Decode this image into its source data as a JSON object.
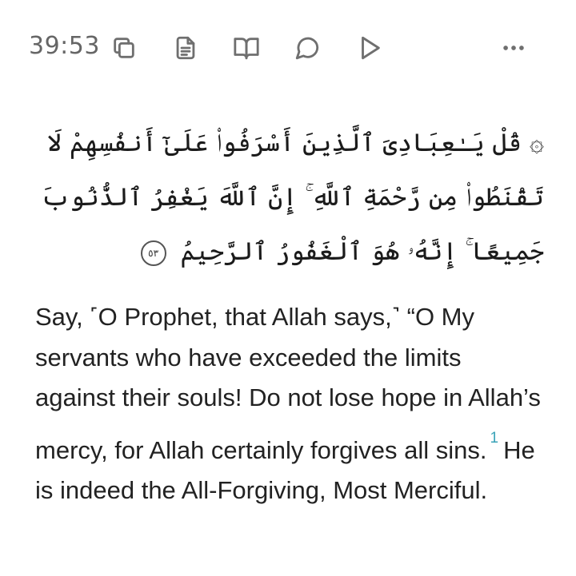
{
  "verse": {
    "number": "39:53",
    "arabic_text": "۞ قُلْ يَـٰعِبَادِىَ ٱلَّذِينَ أَسْرَفُوا۟ عَلَىٰٓ أَنفُسِهِمْ لَا تَقْنَطُوا۟ مِن رَّحْمَةِ ٱللَّهِ ۚ إِنَّ ٱللَّهَ يَغْفِرُ ٱلذُّنُوبَ جَمِيعًا ۚ إِنَّهُۥ هُوَ ٱلْغَفُورُ ٱلرَّحِيمُ",
    "ayah_marker": "٥٣",
    "translation_part1": "Say, ˹O Prophet, that Allah says,˺ “O My servants who have exceeded the limits against their souls! Do not lose hope in Allah’s mercy, for Allah certainly forgives all sins.",
    "footnote_ref": "1",
    "translation_part2": "He is indeed the All-Forgiving, Most Merciful."
  },
  "toolbar": {
    "icons": [
      "copy-icon",
      "tafsir-document-icon",
      "open-book-icon",
      "comment-icon",
      "play-icon",
      "more-options-icon"
    ]
  },
  "colors": {
    "text": "#222222",
    "icon": "#6f6f6f",
    "footnote": "#3aa3b8"
  }
}
